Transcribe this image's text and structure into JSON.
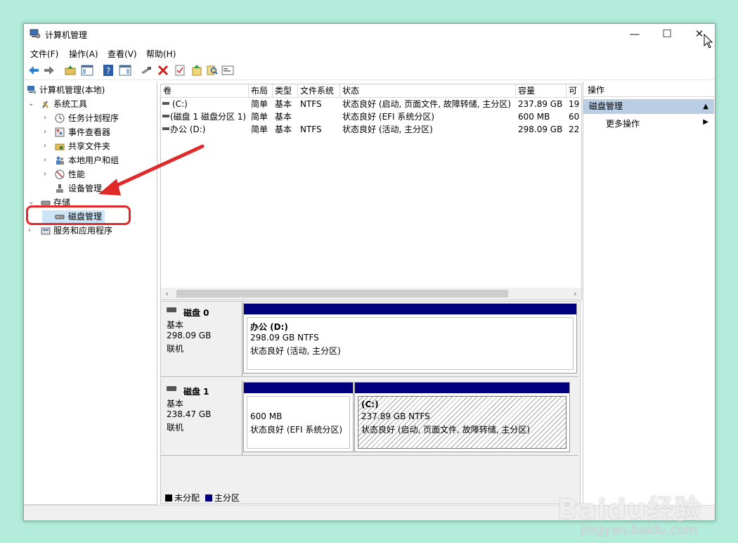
{
  "window": {
    "title": "计算机管理",
    "minimize_glyph": "—",
    "maximize_glyph": "☐",
    "close_glyph": "✕"
  },
  "menu": [
    {
      "label": "文件(F)"
    },
    {
      "label": "操作(A)"
    },
    {
      "label": "查看(V)"
    },
    {
      "label": "帮助(H)"
    }
  ],
  "tree": {
    "root": "计算机管理(本地)",
    "system_tools": "系统工具",
    "task_scheduler": "任务计划程序",
    "event_viewer": "事件查看器",
    "shared_folders": "共享文件夹",
    "local_users": "本地用户和组",
    "performance": "性能",
    "device_manager": "设备管理",
    "storage": "存储",
    "disk_management": "磁盘管理",
    "services_apps": "服务和应用程序"
  },
  "volume_table": {
    "columns": [
      "卷",
      "布局",
      "类型",
      "文件系统",
      "状态",
      "容量",
      "可"
    ],
    "rows": [
      {
        "volume": "(C:)",
        "layout": "简单",
        "type": "基本",
        "fs": "NTFS",
        "status": "状态良好 (启动, 页面文件, 故障转储, 主分区)",
        "capacity": "237.89 GB",
        "free": "19"
      },
      {
        "volume": "(磁盘 1 磁盘分区 1)",
        "layout": "简单",
        "type": "基本",
        "fs": "",
        "status": "状态良好 (EFI 系统分区)",
        "capacity": "600 MB",
        "free": "60"
      },
      {
        "volume": "办公 (D:)",
        "layout": "简单",
        "type": "基本",
        "fs": "NTFS",
        "status": "状态良好 (活动, 主分区)",
        "capacity": "298.09 GB",
        "free": "22"
      }
    ]
  },
  "disks": [
    {
      "name": "磁盘 0",
      "kind": "基本",
      "size": "298.09 GB",
      "state": "联机",
      "partitions": [
        {
          "title": "办公 (D:)",
          "detail": "298.09 GB NTFS",
          "status": "状态良好 (活动, 主分区)"
        }
      ]
    },
    {
      "name": "磁盘 1",
      "kind": "基本",
      "size": "238.47 GB",
      "state": "联机",
      "partitions": [
        {
          "title": "",
          "detail": "600 MB",
          "status": "状态良好 (EFI 系统分区)"
        },
        {
          "title": "(C:)",
          "detail": "237.89 GB NTFS",
          "status": "状态良好 (启动, 页面文件, 故障转储, 主分区)"
        }
      ]
    }
  ],
  "legend": {
    "unallocated": "未分配",
    "primary": "主分区"
  },
  "actions": {
    "header": "操作",
    "section": "磁盘管理",
    "more": "更多操作"
  },
  "watermark": {
    "main": "Baidu经验",
    "sub": "jingyan.baidu.com"
  },
  "colors": {
    "partition_bar": "#00007f",
    "annotation": "#e02a2a",
    "background": "#b3ecdb"
  }
}
